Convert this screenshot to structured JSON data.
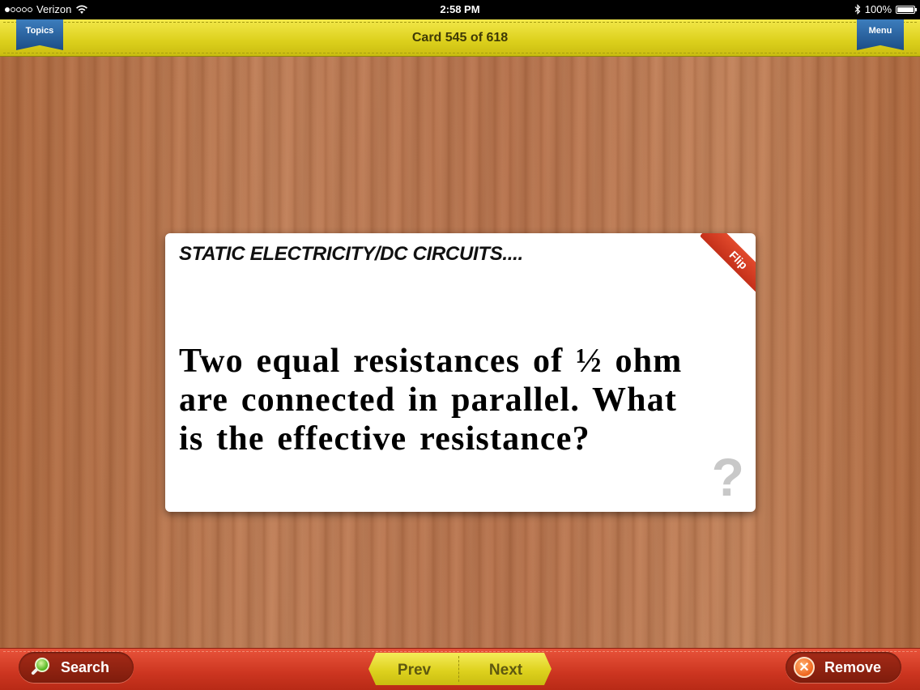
{
  "status_bar": {
    "carrier": "Verizon",
    "time": "2:58 PM",
    "battery": "100%",
    "signal_bars": 1,
    "icons": [
      "wifi-icon",
      "bluetooth-icon",
      "battery-icon"
    ]
  },
  "top_bar": {
    "topics_label": "Topics",
    "card_counter": "Card 545 of 618",
    "menu_label": "Menu"
  },
  "card": {
    "topic": "STATIC ELECTRICITY/DC CIRCUITS....",
    "question": "Two equal resistances of ½ ohm are connected in parallel. What is the effective resistance?",
    "flip_label": "Flip",
    "help_glyph": "?"
  },
  "bottom_bar": {
    "search_label": "Search",
    "prev_label": "Prev",
    "next_label": "Next",
    "remove_label": "Remove",
    "remove_glyph": "✕"
  },
  "colors": {
    "top_bar": "#dcd01c",
    "ribbon_button": "#2a62a3",
    "bottom_bar": "#cc3520",
    "flip_corner": "#d43a22",
    "wood": "#b87550"
  }
}
